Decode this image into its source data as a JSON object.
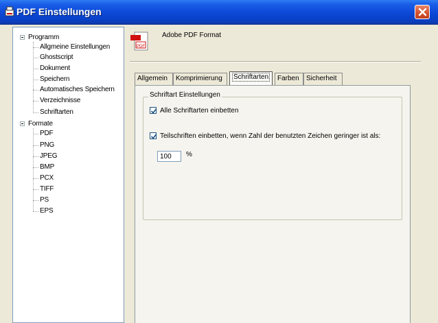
{
  "window": {
    "title": "PDF Einstellungen",
    "accent": "#0b48d6"
  },
  "tree": {
    "programm": {
      "label": "Programm",
      "children": [
        "Allgmeine Einstellungen",
        "Ghostscript",
        "Dokument",
        "Speichern",
        "Automatisches Speichern",
        "Verzeichnisse",
        "Schriftarten"
      ]
    },
    "formate": {
      "label": "Formate",
      "children": [
        "PDF",
        "PNG",
        "JPEG",
        "BMP",
        "PCX",
        "TIFF",
        "PS",
        "EPS"
      ]
    }
  },
  "header": {
    "icon": "pdf-document-icon",
    "icon_text": "PDF",
    "format_label": "Adobe PDF Format"
  },
  "tabs": [
    {
      "label": "Allgemein",
      "active": false
    },
    {
      "label": "Komprimierung",
      "active": false
    },
    {
      "label": "Schriftarten",
      "active": true
    },
    {
      "label": "Farben",
      "active": false
    },
    {
      "label": "Sicherheit",
      "active": false
    }
  ],
  "fonts_group": {
    "title": "Schriftart Einstellungen",
    "embed_all": {
      "label": "Alle Schriftarten einbetten",
      "checked": true
    },
    "subset": {
      "label": "Teilschriften einbetten, wenn Zahl der benutzten Zeichen geringer ist als:",
      "checked": true
    },
    "threshold_value": "100",
    "threshold_unit": "%"
  }
}
